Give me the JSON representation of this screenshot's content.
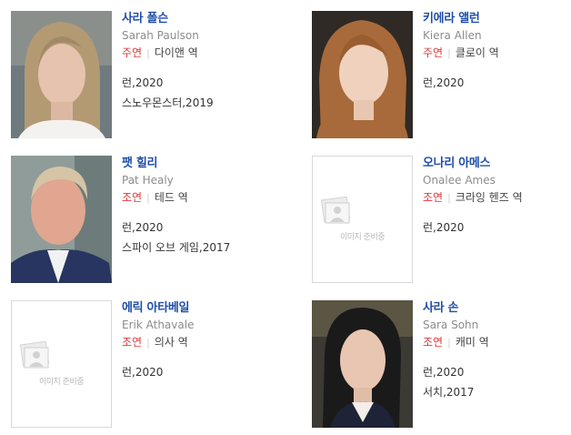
{
  "cast": [
    {
      "name_ko": "사라 폴슨",
      "name_en": "Sarah Paulson",
      "role_type": "주연",
      "role": "다이앤 역",
      "works": [
        "런,2020",
        "스노우몬스터,2019"
      ],
      "photo": "photo"
    },
    {
      "name_ko": "키에라 앨런",
      "name_en": "Kiera Allen",
      "role_type": "주연",
      "role": "클로이 역",
      "works": [
        "런,2020"
      ],
      "photo": "photo"
    },
    {
      "name_ko": "팻 힐리",
      "name_en": "Pat Healy",
      "role_type": "조연",
      "role": "테드 역",
      "works": [
        "런,2020",
        "스파이 오브 게임,2017"
      ],
      "photo": "photo"
    },
    {
      "name_ko": "오나리 아메스",
      "name_en": "Onalee Ames",
      "role_type": "조연",
      "role": "크라잉 헨즈 역",
      "works": [
        "런,2020"
      ],
      "photo": "placeholder"
    },
    {
      "name_ko": "에릭 아타베일",
      "name_en": "Erik Athavale",
      "role_type": "조연",
      "role": "의사 역",
      "works": [
        "런,2020"
      ],
      "photo": "placeholder"
    },
    {
      "name_ko": "사라 손",
      "name_en": "Sara Sohn",
      "role_type": "조연",
      "role": "캐미 역",
      "works": [
        "런,2020",
        "서치,2017"
      ],
      "photo": "photo"
    }
  ],
  "placeholder_text": "이미지 준비중",
  "colors": {
    "name": "#1f4ea8",
    "role_type": "#e03a3a",
    "english": "#8c8c8c"
  }
}
